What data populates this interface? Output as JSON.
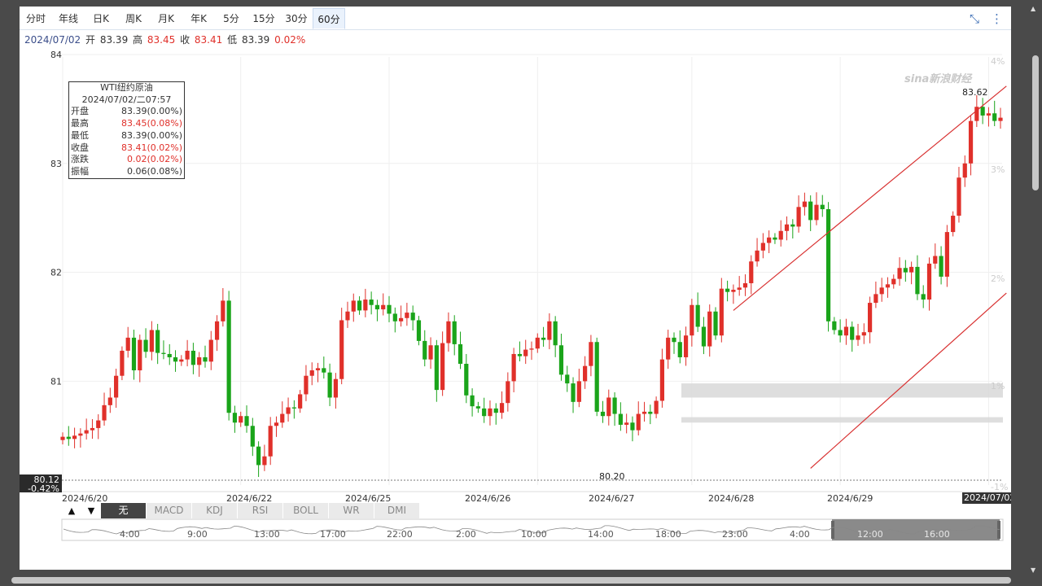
{
  "tabs": [
    {
      "label": "分时",
      "active": false
    },
    {
      "label": "年线",
      "active": false
    },
    {
      "label": "日K",
      "active": false
    },
    {
      "label": "周K",
      "active": false
    },
    {
      "label": "月K",
      "active": false
    },
    {
      "label": "年K",
      "active": false
    },
    {
      "label": "5分",
      "active": false
    },
    {
      "label": "15分",
      "active": false
    },
    {
      "label": "30分",
      "active": false
    },
    {
      "label": "60分",
      "active": true
    }
  ],
  "ohlc": {
    "date": "2024/07/02",
    "open_label": "开",
    "open": "83.39",
    "high_label": "高",
    "high": "83.45",
    "close_label": "收",
    "close": "83.41",
    "low_label": "低",
    "low": "83.39",
    "change": "0.02%"
  },
  "info_box": {
    "title": "WTI纽约原油",
    "datetime": "2024/07/02/二07:57",
    "rows": [
      {
        "label": "开盘",
        "value": "83.39(0.00%)",
        "color": "#333333"
      },
      {
        "label": "最高",
        "value": "83.45(0.08%)",
        "color": "#e0302a"
      },
      {
        "label": "最低",
        "value": "83.39(0.00%)",
        "color": "#333333"
      },
      {
        "label": "收盘",
        "value": "83.41(0.02%)",
        "color": "#e0302a"
      },
      {
        "label": "涨跌",
        "value": "0.02(0.02%)",
        "color": "#e0302a"
      },
      {
        "label": "振幅",
        "value": "0.06(0.08%)",
        "color": "#333333"
      }
    ]
  },
  "indicators": [
    {
      "label": "无",
      "active": true
    },
    {
      "label": "MACD",
      "active": false
    },
    {
      "label": "KDJ",
      "active": false
    },
    {
      "label": "RSI",
      "active": false
    },
    {
      "label": "BOLL",
      "active": false
    },
    {
      "label": "WR",
      "active": false
    },
    {
      "label": "DMI",
      "active": false
    }
  ],
  "arrows": [
    "▲",
    "▼"
  ],
  "watermark": "sina新浪财经",
  "current_time_label": "2024/07/02 07:57",
  "base_price_label": "80.12",
  "base_pct_label": "-0.42%",
  "max_label": "83.62",
  "min_label": "80.20",
  "nav_time_labels": [
    "4:00",
    "9:00",
    "13:00",
    "17:00",
    "22:00",
    "2:00",
    "10:00",
    "14:00",
    "18:00",
    "23:00",
    "4:00",
    "12:00",
    "16:00"
  ],
  "colors": {
    "up": "#e0302a",
    "down": "#1aa41a",
    "channel": "#d83030",
    "accent": "#3b6db5"
  },
  "chart_data": {
    "type": "candlestick",
    "y_axis": {
      "min": 80.0,
      "max": 84.0,
      "ticks": [
        81,
        82,
        83,
        84
      ]
    },
    "y_axis_right": {
      "ticks": [
        "-1%",
        "1%",
        "2%",
        "3%",
        "4%"
      ]
    },
    "x_tick_labels": [
      "2024/6/20",
      "2024/6/22",
      "2024/6/25",
      "2024/6/26",
      "2024/6/27",
      "2024/6/28",
      "2024/6/29"
    ],
    "closes": [
      80.49,
      80.47,
      80.5,
      80.52,
      80.55,
      80.57,
      80.64,
      80.78,
      80.85,
      81.05,
      81.28,
      81.4,
      81.1,
      81.38,
      81.27,
      81.47,
      81.26,
      81.25,
      81.22,
      81.18,
      81.2,
      81.28,
      81.15,
      81.22,
      81.18,
      81.38,
      81.55,
      81.74,
      80.71,
      80.62,
      80.68,
      80.59,
      80.4,
      80.23,
      80.31,
      80.59,
      80.62,
      80.7,
      80.76,
      80.75,
      80.88,
      81.05,
      81.1,
      81.12,
      81.08,
      80.85,
      81.02,
      81.56,
      81.64,
      81.74,
      81.65,
      81.75,
      81.7,
      81.66,
      81.7,
      81.62,
      81.55,
      81.58,
      81.63,
      81.56,
      81.37,
      81.2,
      81.33,
      80.92,
      81.35,
      81.55,
      81.34,
      81.16,
      80.87,
      80.77,
      80.75,
      80.68,
      80.75,
      80.71,
      80.8,
      81.0,
      81.25,
      81.23,
      81.29,
      81.3,
      81.4,
      81.38,
      81.55,
      81.33,
      81.06,
      80.98,
      80.81,
      81.0,
      81.14,
      81.36,
      80.72,
      80.68,
      80.85,
      80.7,
      80.6,
      80.62,
      80.55,
      80.7,
      80.72,
      80.7,
      80.82,
      81.2,
      81.4,
      81.36,
      81.22,
      81.42,
      81.7,
      81.5,
      81.32,
      81.64,
      81.42,
      81.85,
      81.82,
      81.84,
      81.86,
      81.9,
      82.1,
      82.2,
      82.27,
      82.32,
      82.3,
      82.38,
      82.44,
      82.42,
      82.6,
      82.65,
      82.48,
      82.62,
      82.58,
      81.55,
      81.47,
      81.42,
      81.5,
      81.38,
      81.42,
      81.45,
      81.72,
      81.8,
      81.86,
      81.89,
      81.94,
      82.04,
      82.0,
      82.05,
      81.8,
      81.75,
      82.08,
      82.15,
      81.96,
      82.37,
      82.52,
      82.87,
      83.0,
      83.39,
      83.52,
      83.44,
      83.46,
      83.39,
      83.42
    ],
    "overlap_bands": [
      {
        "low": 80.85,
        "high": 80.98
      },
      {
        "low": 80.62,
        "high": 80.67
      }
    ],
    "channel_upper": [
      {
        "x_index": 113,
        "price": 81.65
      },
      {
        "x_index": 159,
        "price": 83.71
      }
    ],
    "channel_lower": [
      {
        "x_index": 126,
        "price": 80.2
      },
      {
        "x_index": 159,
        "price": 81.81
      }
    ]
  }
}
